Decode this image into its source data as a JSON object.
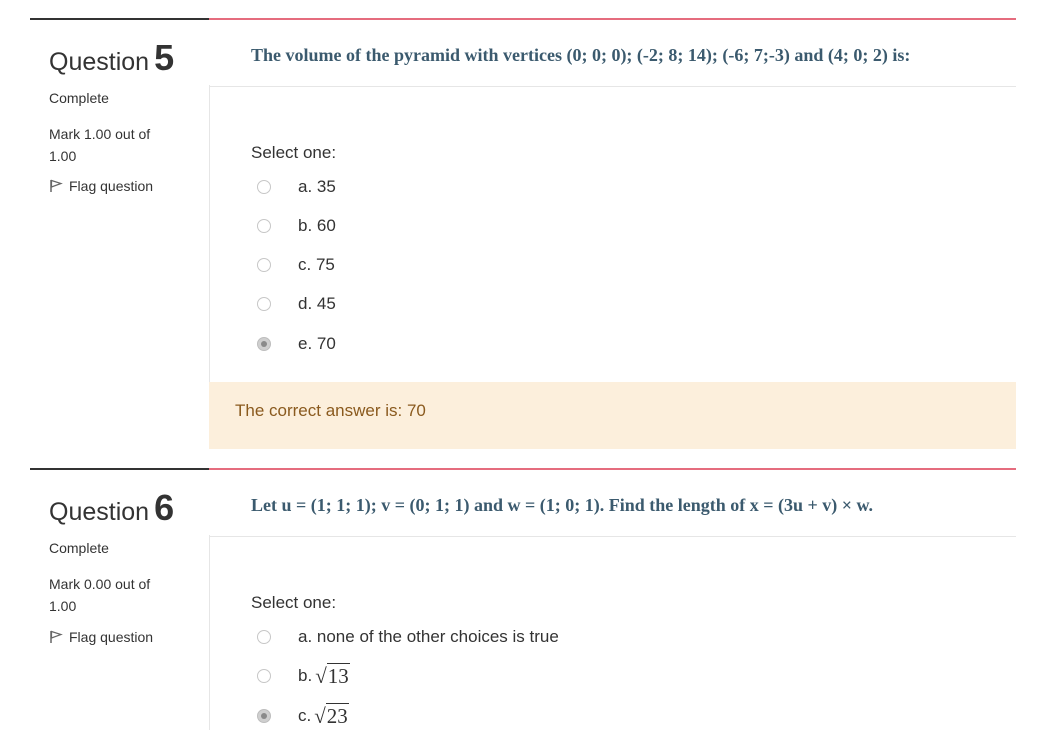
{
  "questions": [
    {
      "title_word": "Question",
      "number": "5",
      "state": "Complete",
      "grade": "Mark 1.00 out of 1.00",
      "flag_label": "Flag question",
      "text": "The volume of the pyramid with vertices (0; 0; 0); (-2; 8; 14); (-6; 7;-3) and (4; 0; 2) is:",
      "prompt": "Select one:",
      "options": [
        {
          "label": "a. 35",
          "checked": false
        },
        {
          "label": "b. 60",
          "checked": false
        },
        {
          "label": "c. 75",
          "checked": false
        },
        {
          "label": "d. 45",
          "checked": false
        },
        {
          "label": "e. 70",
          "checked": true
        }
      ],
      "feedback": "The correct answer is: 70"
    },
    {
      "title_word": "Question",
      "number": "6",
      "state": "Complete",
      "grade": "Mark 0.00 out of 1.00",
      "flag_label": "Flag question",
      "text": "Let u = (1; 1; 1); v = (0; 1; 1) and w = (1; 0; 1). Find the length of x = (3u + v) × w.",
      "prompt": "Select one:",
      "options": [
        {
          "label": "a. none of the other choices is true",
          "checked": false
        },
        {
          "label": "b.",
          "radicand": "13",
          "checked": false
        },
        {
          "label": "c.",
          "radicand": "23",
          "checked": true
        }
      ]
    }
  ]
}
